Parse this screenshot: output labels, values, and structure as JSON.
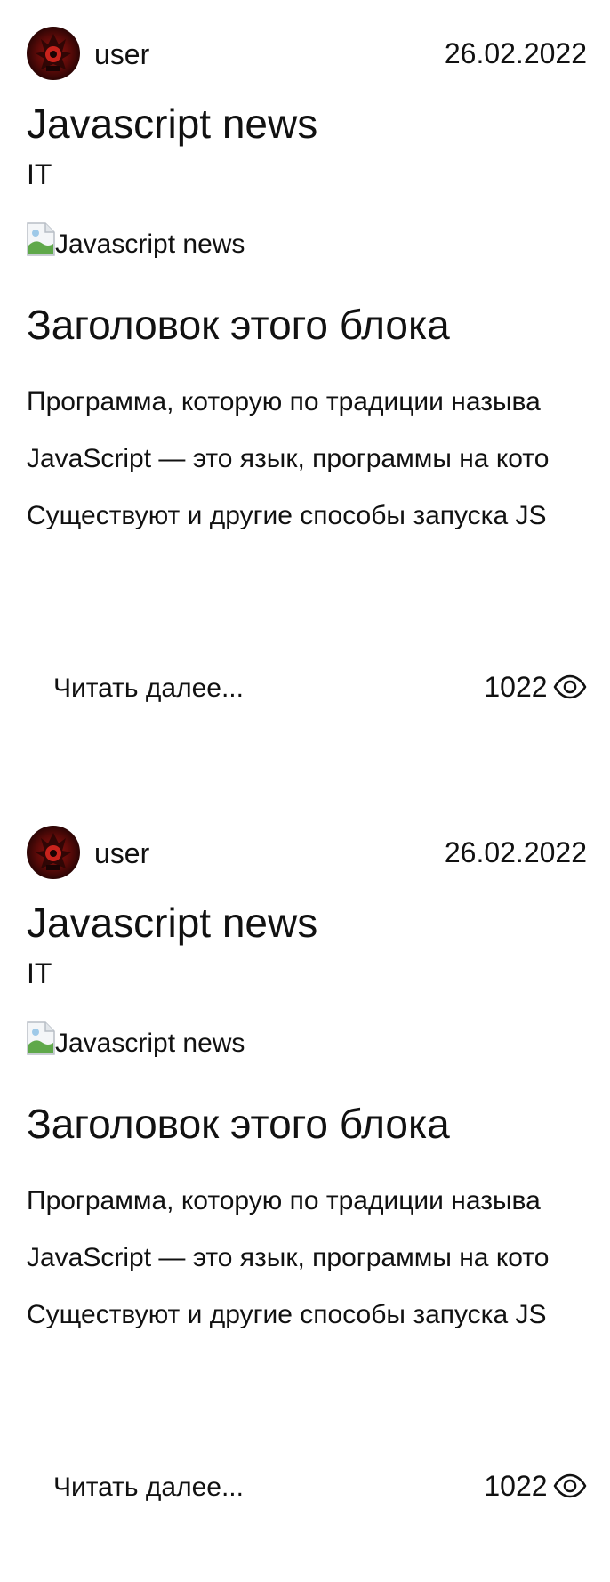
{
  "posts": [
    {
      "author": "user",
      "date": "26.02.2022",
      "title": "Javascript news",
      "category": "IT",
      "image_alt": "Javascript news",
      "block_title": "Заголовок этого блока",
      "paragraphs": [
        "Программа, которую по традиции называ",
        "JavaScript — это язык, программы на кото",
        "Существуют и другие способы запуска JS"
      ],
      "read_more": "Читать далее...",
      "views": "1022",
      "views_icon": "eye-icon"
    },
    {
      "author": "user",
      "date": "26.02.2022",
      "title": "Javascript news",
      "category": "IT",
      "image_alt": "Javascript news",
      "block_title": "Заголовок этого блока",
      "paragraphs": [
        "Программа, которую по традиции называ",
        "JavaScript — это язык, программы на кото",
        "Существуют и другие способы запуска JS"
      ],
      "read_more": "Читать далее...",
      "views": "1022",
      "views_icon": "eye-icon"
    }
  ],
  "colors": {
    "text": "#111111",
    "background": "#ffffff",
    "avatar_red": "#9a1410"
  }
}
